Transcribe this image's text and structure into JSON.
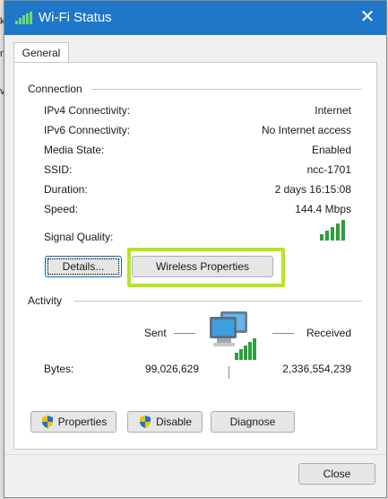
{
  "window": {
    "title": "Wi-Fi Status",
    "close_glyph": "✕"
  },
  "background_glyphs": [
    "k",
    "n",
    "v:"
  ],
  "tabs": [
    {
      "label": "General"
    }
  ],
  "connection": {
    "label": "Connection",
    "rows": [
      {
        "label": "IPv4 Connectivity:",
        "value": "Internet"
      },
      {
        "label": "IPv6 Connectivity:",
        "value": "No Internet access"
      },
      {
        "label": "Media State:",
        "value": "Enabled"
      },
      {
        "label": "SSID:",
        "value": "ncc-1701"
      },
      {
        "label": "Duration:",
        "value": "2 days 16:15:08"
      },
      {
        "label": "Speed:",
        "value": "144.4 Mbps"
      }
    ],
    "signal_quality_label": "Signal Quality:",
    "signal_bars_filled": 5,
    "signal_bars_total": 5,
    "details_button": "Details...",
    "wireless_properties_button": "Wireless Properties"
  },
  "activity": {
    "label": "Activity",
    "sent_label": "Sent",
    "received_label": "Received",
    "bytes_label": "Bytes:",
    "bytes_sent": "99,026,629",
    "bytes_received": "2,336,554,239"
  },
  "actions": {
    "properties_button": "Properties",
    "disable_button": "Disable",
    "diagnose_button": "Diagnose"
  },
  "footer": {
    "close_button": "Close"
  },
  "colors": {
    "titlebar": "#1f77c9",
    "signal_green": "#2e9e3e",
    "highlight": "#b5e61d"
  }
}
